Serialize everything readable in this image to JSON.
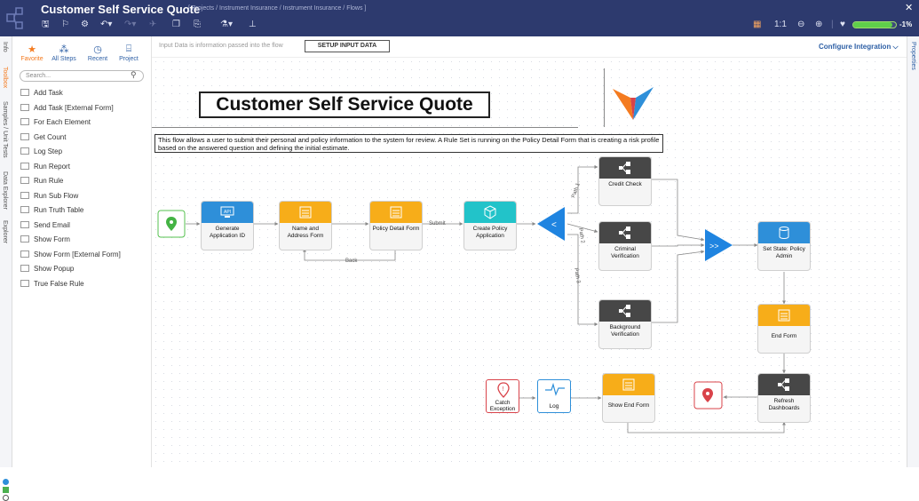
{
  "header": {
    "title": "Customer Self Service Quote",
    "breadcrumb": "[ Projects / Instrument Insurance / Instrument Insurance / Flows ]",
    "health_percent": "-1%",
    "health_fill": 0.92,
    "health_color": "#5fcf4a"
  },
  "left_rail": {
    "tabs": [
      "Info",
      "Toolbox",
      "Samples / Unit Tests",
      "Data Explorer",
      "Explorer"
    ]
  },
  "right_rail": {
    "tab": "Properties"
  },
  "toolbox": {
    "tabs": [
      "Favorite",
      "All Steps",
      "Recent",
      "Project"
    ],
    "search_placeholder": "Search...",
    "items": [
      "Add Task",
      "Add Task [External Form]",
      "For Each Element",
      "Get Count",
      "Log Step",
      "Run Report",
      "Run Rule",
      "Run Sub Flow",
      "Run Truth Table",
      "Send Email",
      "Show Form",
      "Show Form [External Form]",
      "Show Popup",
      "True False Rule"
    ]
  },
  "subbar": {
    "input_info": "Input Data is information passed into the flow",
    "setup_button": "SETUP INPUT DATA",
    "configure": "Configure Integration ⌵"
  },
  "canvas": {
    "title": "Customer Self Service Quote",
    "description": "This flow allows a user to submit their personal and policy information to the system for review. A Rule Set is running on the Policy Detail Form that is creating a risk profile based on the answered question and defining the initial estimate.",
    "nodes": {
      "generate": "Generate Application ID",
      "name_form": "Name and Address Form",
      "policy_form": "Policy Detail Form",
      "create_app": "Create Policy Application",
      "credit": "Credit Check",
      "criminal": "Criminal Verification",
      "background": "Background Verification",
      "set_state": "Set State: Policy Admin",
      "end_form": "End Form",
      "refresh": "Refresh Dashboards",
      "catch": "Catch Exception",
      "log": "Log",
      "show_end": "Show End Form"
    },
    "edge_labels": {
      "submit": "Submit",
      "back": "Back",
      "path1": "Path 1",
      "path2": "Path 2",
      "path3": "Path 3"
    }
  },
  "colors": {
    "header_bg": "#2d3a6e",
    "accent_orange": "#f47b20",
    "node_blue": "#2e8fd9",
    "node_orange": "#f7ad19",
    "node_teal": "#22c3c9",
    "node_dark": "#474747"
  }
}
